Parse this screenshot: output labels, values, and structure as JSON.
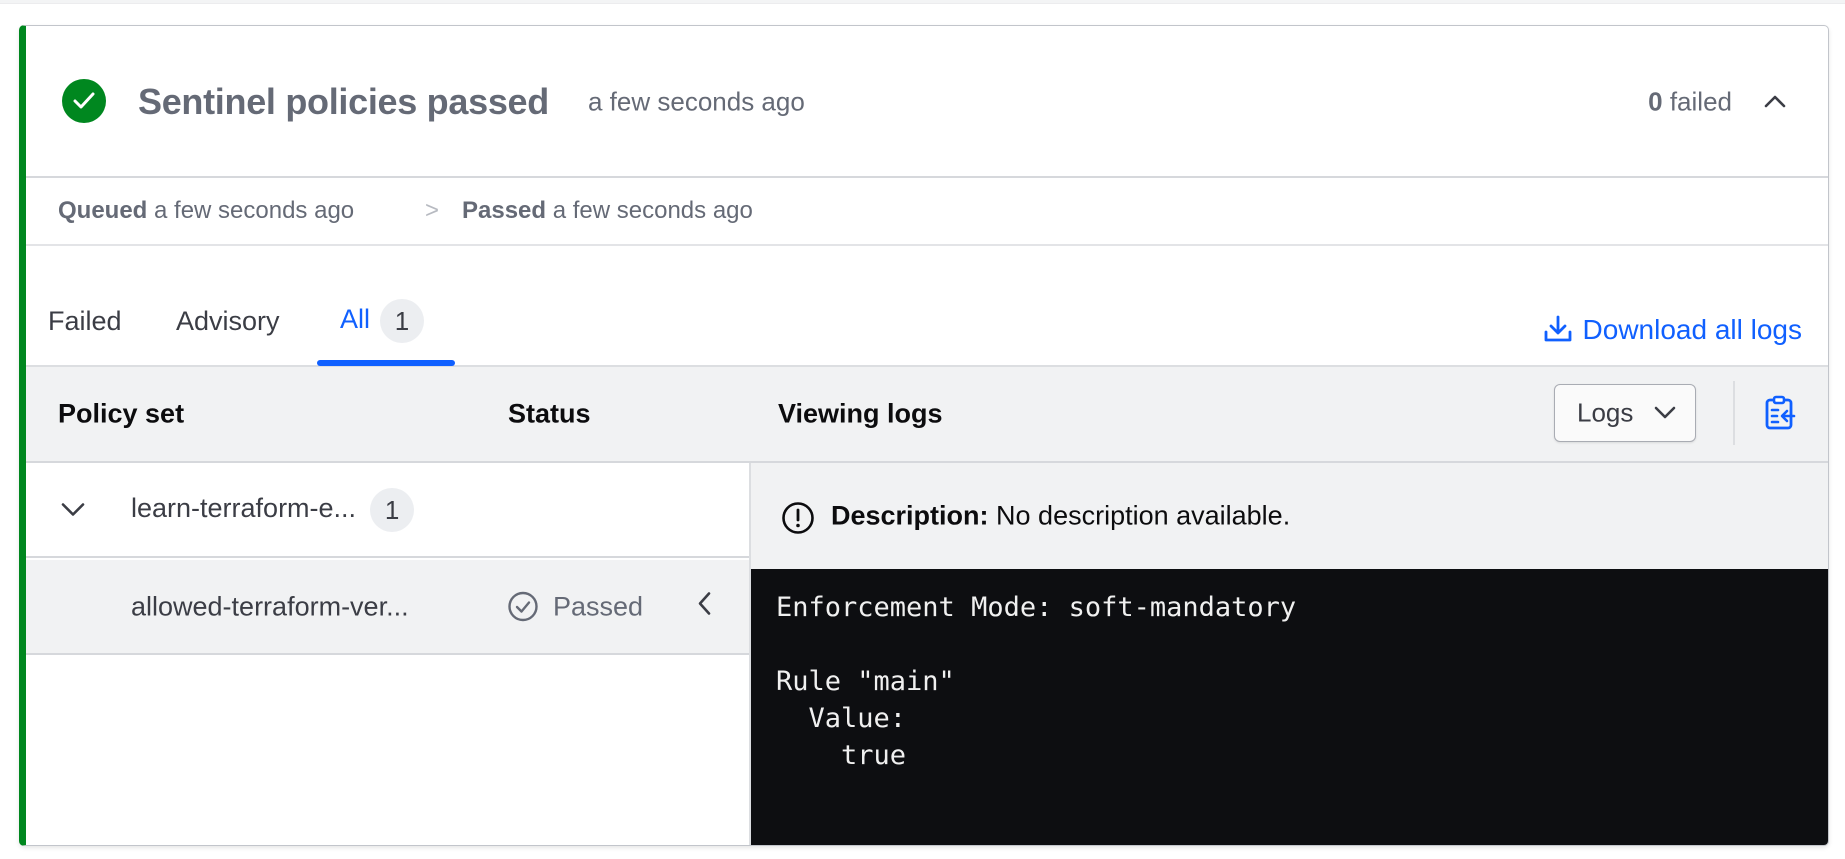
{
  "header": {
    "status_icon": "check-circle-filled-icon",
    "title": "Sentinel policies passed",
    "time": "a few seconds ago",
    "failed_count": "0",
    "failed_label": " failed",
    "collapse_icon": "chevron-up-icon"
  },
  "timeline": {
    "steps": [
      {
        "label": "Queued",
        "time": " a few seconds ago"
      },
      {
        "label": "Passed",
        "time": " a few seconds ago"
      }
    ],
    "separator": ">"
  },
  "tabs": {
    "items": [
      {
        "label": "Failed",
        "active": false
      },
      {
        "label": "Advisory",
        "active": false
      },
      {
        "label": "All",
        "count": "1",
        "active": true
      }
    ],
    "download_label": "Download all logs",
    "download_icon": "download-icon"
  },
  "table": {
    "headers": {
      "policy_set": "Policy set",
      "status": "Status",
      "viewing": "Viewing logs"
    },
    "view_select": {
      "value": "Logs",
      "icon": "chevron-down-icon"
    },
    "copy_icon": "clipboard-copy-icon",
    "rows": [
      {
        "name": "learn-terraform-e...",
        "count": "1",
        "expand_icon": "chevron-down-icon"
      },
      {
        "name": "allowed-terraform-ver...",
        "status": "Passed",
        "status_icon": "check-circle-outline-icon",
        "selected_icon": "chevron-left-icon"
      }
    ]
  },
  "details": {
    "description_label": "Description:",
    "description_text": " No description available.",
    "info_icon": "alert-circle-icon",
    "log_output": "Enforcement Mode: soft-mandatory\n\nRule \"main\"\n  Value:\n    true"
  },
  "colors": {
    "success": "#00871f",
    "accent": "#1060ff",
    "muted_text": "#656a76",
    "terminal_bg": "#0d0e11"
  }
}
